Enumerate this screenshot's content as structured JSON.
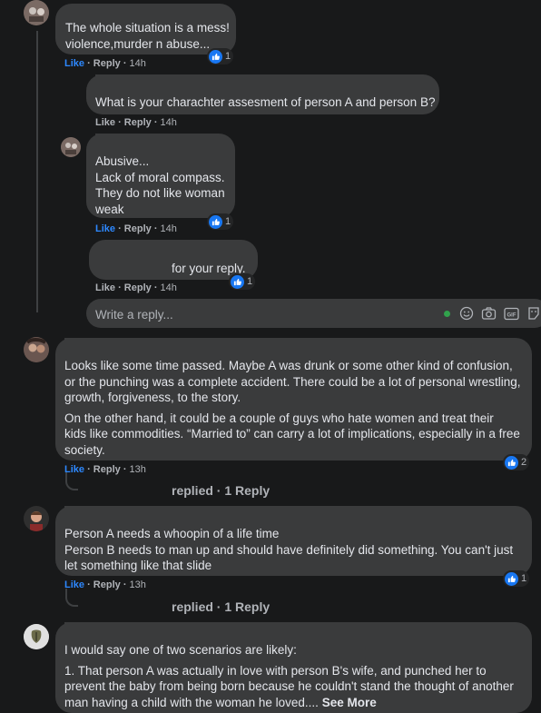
{
  "c1": {
    "lines": [
      "The whole situation is a mess!",
      "violence,murder n abuse..."
    ],
    "like": "Like",
    "reply": "Reply",
    "time": "14h",
    "reactions": "1"
  },
  "c2": {
    "text": "What is your charachter assesment of person A and person B?",
    "like": "Like",
    "reply": "Reply",
    "time": "14h"
  },
  "c3": {
    "lines": [
      "Abusive...",
      "Lack of moral compass.",
      "They do not like woman",
      "weak"
    ],
    "like": "Like",
    "reply": "Reply",
    "time": "14h",
    "reactions": "1"
  },
  "c4": {
    "text": "for your reply.",
    "like": "Like",
    "reply": "Reply",
    "time": "14h",
    "reactions": "1"
  },
  "reply_box": {
    "placeholder": "Write a reply..."
  },
  "c5": {
    "para1": [
      "Looks like some time passed. Maybe A was drunk or some other kind of confusion,",
      "or the punching was a complete accident. There could be a lot of personal wrestling,",
      "growth, forgiveness, to the story."
    ],
    "para2": [
      "On the other hand, it could be a couple of guys who hate women and treat their",
      "kids like commodities. “Married to” can carry a lot of implications, especially in a free",
      "society."
    ],
    "like": "Like",
    "reply": "Reply",
    "time": "13h",
    "reactions": "2",
    "replies": "replied · 1 Reply"
  },
  "c6": {
    "lines": [
      "Person A needs a whoopin of a life time",
      "Person B needs to man up and should have definitely did something. You can't just",
      "let something like that slide"
    ],
    "like": "Like",
    "reply": "Reply",
    "time": "13h",
    "reactions": "1",
    "replies": "replied · 1 Reply"
  },
  "c7": {
    "line1": "I would say one of two scenarios are likely:",
    "para": [
      "1. That person A was actually in love with person B's wife, and punched her to",
      "prevent the baby from being born because he couldn't stand the thought of another"
    ],
    "last": "man having a child with the woman he loved....",
    "see_more": "See More"
  },
  "colors": {
    "background": "#18191a",
    "bubble": "#3a3b3c",
    "accent": "#2d88ff",
    "muted": "#b0b3b8",
    "text": "#e4e6eb",
    "online": "#31a24c"
  }
}
